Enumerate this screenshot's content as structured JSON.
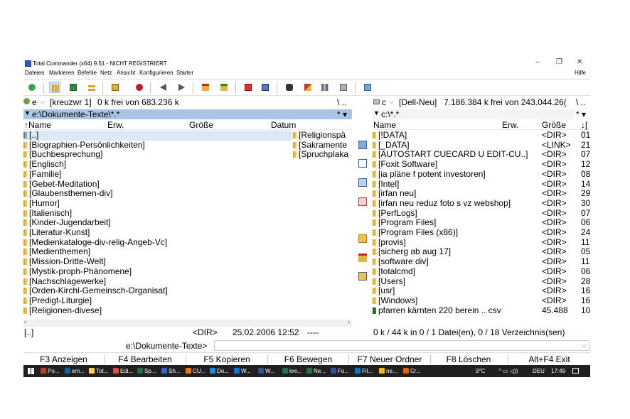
{
  "window": {
    "title": "Total Commander (x64) 9.51 - NICHT REGISTRIERT",
    "minimize": "–",
    "restore": "❐",
    "close": "✕"
  },
  "menu": {
    "items": [
      "Dateien",
      "Markieren",
      "Befehle",
      "Netz",
      "Ansicht",
      "Konfigurieren",
      "Starter"
    ],
    "help": "Hilfe"
  },
  "toolbar": {
    "icons": [
      "refresh-icon",
      "brief-view-icon",
      "thumbnail-view-icon",
      "tree-view-icon",
      "sync-dirs-icon",
      "bug-icon",
      "back-arrow-icon",
      "forward-arrow-icon",
      "pack-icon",
      "unpack-icon",
      "ftp-icon",
      "ftp-new-icon",
      "search-binoculars-icon",
      "rename-icon",
      "compare-icon",
      "dir-sync-icon",
      "notepad-icon"
    ],
    "selected_index": 1
  },
  "left": {
    "drive": "e",
    "drive_label": "[kreuzwr 1]",
    "free": "0 k frei von 683.236 k",
    "nav": "\\ ..",
    "path": "e:\\Dokumente-Texte\\*.*",
    "columns": {
      "name": "↑Name",
      "ext": "Erw.",
      "size": "Größe",
      "date": "Datum"
    },
    "items": [
      "[..]",
      "[Biographien-Persönlichkeiten]",
      "[Buchbesprechung]",
      "[Englisch]",
      "[Familie]",
      "[Gebet-Meditation]",
      "[Glaubensthemen-div]",
      "[Humor]",
      "[Italienisch]",
      "[Kinder-Jugendarbeit]",
      "[Literatur-Kunst]",
      "[Medienkataloge-div-relig-Angeb-Vc]",
      "[Medienthemen]",
      "[Mission-Dritte-Welt]",
      "[Mystik-proph-Phänomene]",
      "[Nachschlagewerke]",
      "[Orden-Kirchl-Gemeinsch-Organisat]",
      "[Predigt-Liturgie]",
      "[Religionen-divese]"
    ],
    "items_col2": [
      "[Religionspä",
      "[Sakramente",
      "[Spruchplaka"
    ],
    "status": {
      "name": "[..]",
      "size": "<DIR>",
      "date": "25.02.2006 12:52",
      "attr": "----"
    }
  },
  "right": {
    "drive": "c",
    "drive_label": "[Dell-Neu]",
    "free": "7.186.384 k frei von 243.044.26(",
    "nav": "\\ ..",
    "path": "c:\\*.*",
    "columns": {
      "name": "Name",
      "ext": "Erw.",
      "size": "Größe",
      "sort": "↓["
    },
    "items": [
      {
        "name": "[!DATA]",
        "size": "<DIR>",
        "d": "01"
      },
      {
        "name": "[_DATA]",
        "size": "<LINK>",
        "d": "21"
      },
      {
        "name": "[AUTOSTART CUECARD U EDIT-CU..]",
        "size": "<DIR>",
        "d": "07"
      },
      {
        "name": "[Foxit Software]",
        "size": "<DIR>",
        "d": "12"
      },
      {
        "name": "[ia pläne f potent investoren]",
        "size": "<DIR>",
        "d": "08"
      },
      {
        "name": "[Intel]",
        "size": "<DIR>",
        "d": "14"
      },
      {
        "name": "[irfan neu]",
        "size": "<DIR>",
        "d": "29"
      },
      {
        "name": "[irfan neu reduz foto s vz webshop]",
        "size": "<DIR>",
        "d": "30"
      },
      {
        "name": "[PerfLogs]",
        "size": "<DIR>",
        "d": "07"
      },
      {
        "name": "[Program Files]",
        "size": "<DIR>",
        "d": "06"
      },
      {
        "name": "[Program Files (x86)]",
        "size": "<DIR>",
        "d": "24"
      },
      {
        "name": "[provis]",
        "size": "<DIR>",
        "d": "11"
      },
      {
        "name": "[sicherg ab aug 17]",
        "size": "<DIR>",
        "d": "05"
      },
      {
        "name": "[software div]",
        "size": "<DIR>",
        "d": "11"
      },
      {
        "name": "[totalcmd]",
        "size": "<DIR>",
        "d": "06"
      },
      {
        "name": "[Users]",
        "size": "<DIR>",
        "d": "28"
      },
      {
        "name": "[usr]",
        "size": "<DIR>",
        "d": "16"
      },
      {
        "name": "[Windows]",
        "size": "<DIR>",
        "d": "16"
      },
      {
        "name": "pfarren kärnten 220 berein .. csv",
        "size": "45.488",
        "d": "10"
      }
    ],
    "status": "0 k / 44 k in 0 / 1 Datei(en), 0 / 18 Verzeichnis(sen)"
  },
  "cmdline": {
    "path": "e:\\Dokumente-Texte>",
    "value": ""
  },
  "fkeys": [
    "F3 Anzeigen",
    "F4 Bearbeiten",
    "F5 Kopieren",
    "F6 Bewegen",
    "F7 Neuer Ordner",
    "F8 Löschen",
    "Alt+F4 Exit"
  ],
  "taskbar": {
    "items": [
      "Po...",
      "em...",
      "Tot...",
      "Edi...",
      "Sp...",
      "Sh...",
      "CU...",
      "Do...",
      "W...",
      "W...",
      "kre...",
      "Ne...",
      "Fo...",
      "Fil...",
      "ne...",
      "Cr..."
    ],
    "weather": "9°C",
    "lang": "DEU",
    "time": "17:49"
  },
  "colors": {
    "active_path": "#a7c6e6",
    "folder": "#f2c34a",
    "taskbar": "#202020"
  }
}
